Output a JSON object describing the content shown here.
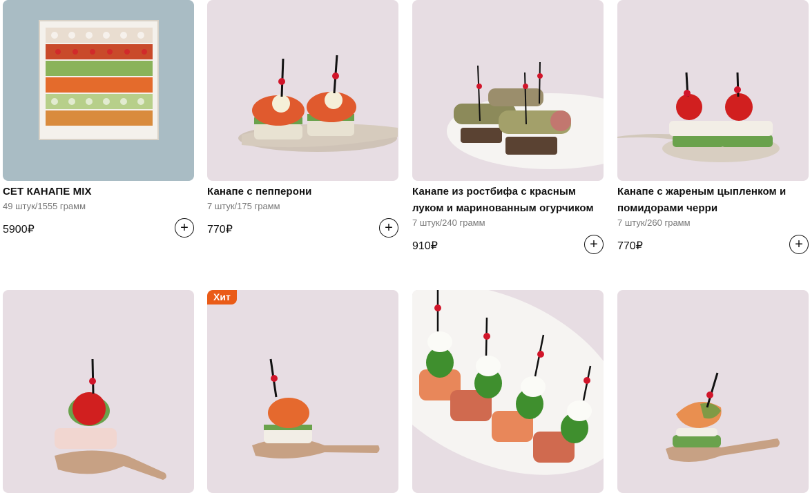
{
  "products": [
    {
      "title": "СЕТ КАНАПЕ MIX",
      "qty": "49 штук/1555 грамм",
      "price": "5900₽",
      "add": "+"
    },
    {
      "title": "Канапе с пепперони",
      "qty": "7 штук/175 грамм",
      "price": "770₽",
      "add": "+"
    },
    {
      "title": "Канапе из ростбифа с красным луком и маринованным огурчиком",
      "qty": "7 штук/240 грамм",
      "price": "910₽",
      "add": "+"
    },
    {
      "title": "Канапе с жареным цыпленком и помидорами черри",
      "qty": "7 штук/260 грамм",
      "price": "770₽",
      "add": "+"
    }
  ],
  "second_row": {
    "badge": "Хит"
  },
  "colors": {
    "badge": "#ea5b17",
    "photo_bg": "#e7dde3",
    "set_bg": "#a9bcc4"
  },
  "icons": [
    "plus-icon"
  ]
}
